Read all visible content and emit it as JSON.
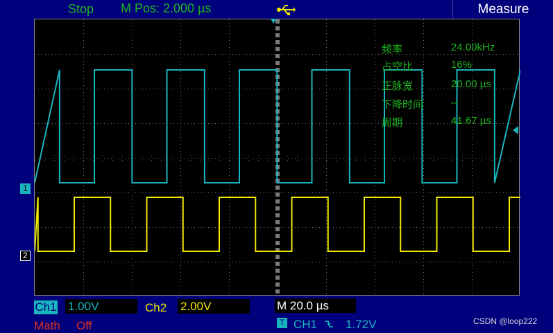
{
  "header": {
    "status": "Stop",
    "m_pos": "M Pos: 2.000 µs",
    "usb_icon": "usb-icon",
    "measure_tab": "Measure"
  },
  "measurements": [
    {
      "label": "频率",
      "value": "24.00kHz"
    },
    {
      "label": "占空比",
      "value": "16%"
    },
    {
      "label": "正脉宽",
      "value": "20.00 µs"
    },
    {
      "label": "下降时间",
      "value": "--"
    },
    {
      "label": "周期",
      "value": "41.67 µs"
    }
  ],
  "markers": {
    "ch1": "1",
    "ch2": "2"
  },
  "bottom": {
    "ch1_label": "Ch1",
    "ch1_scale": "1.00V",
    "ch2_label": "Ch2",
    "ch2_scale": "2.00V",
    "time_scale": "M 20.0 µs",
    "math_label": "Math",
    "math_state": "Off",
    "trigger_icon": "T",
    "trigger_source": "CH1",
    "trigger_edge_icon": "falling-edge-icon",
    "trigger_level": "1.72V"
  },
  "watermark": "CSDN @loop222",
  "colors": {
    "ch1": "#19b5bf",
    "ch2": "#f2ea00",
    "status_green": "#1fb41f",
    "math_red": "#e0321e",
    "background": "#00007c"
  }
}
